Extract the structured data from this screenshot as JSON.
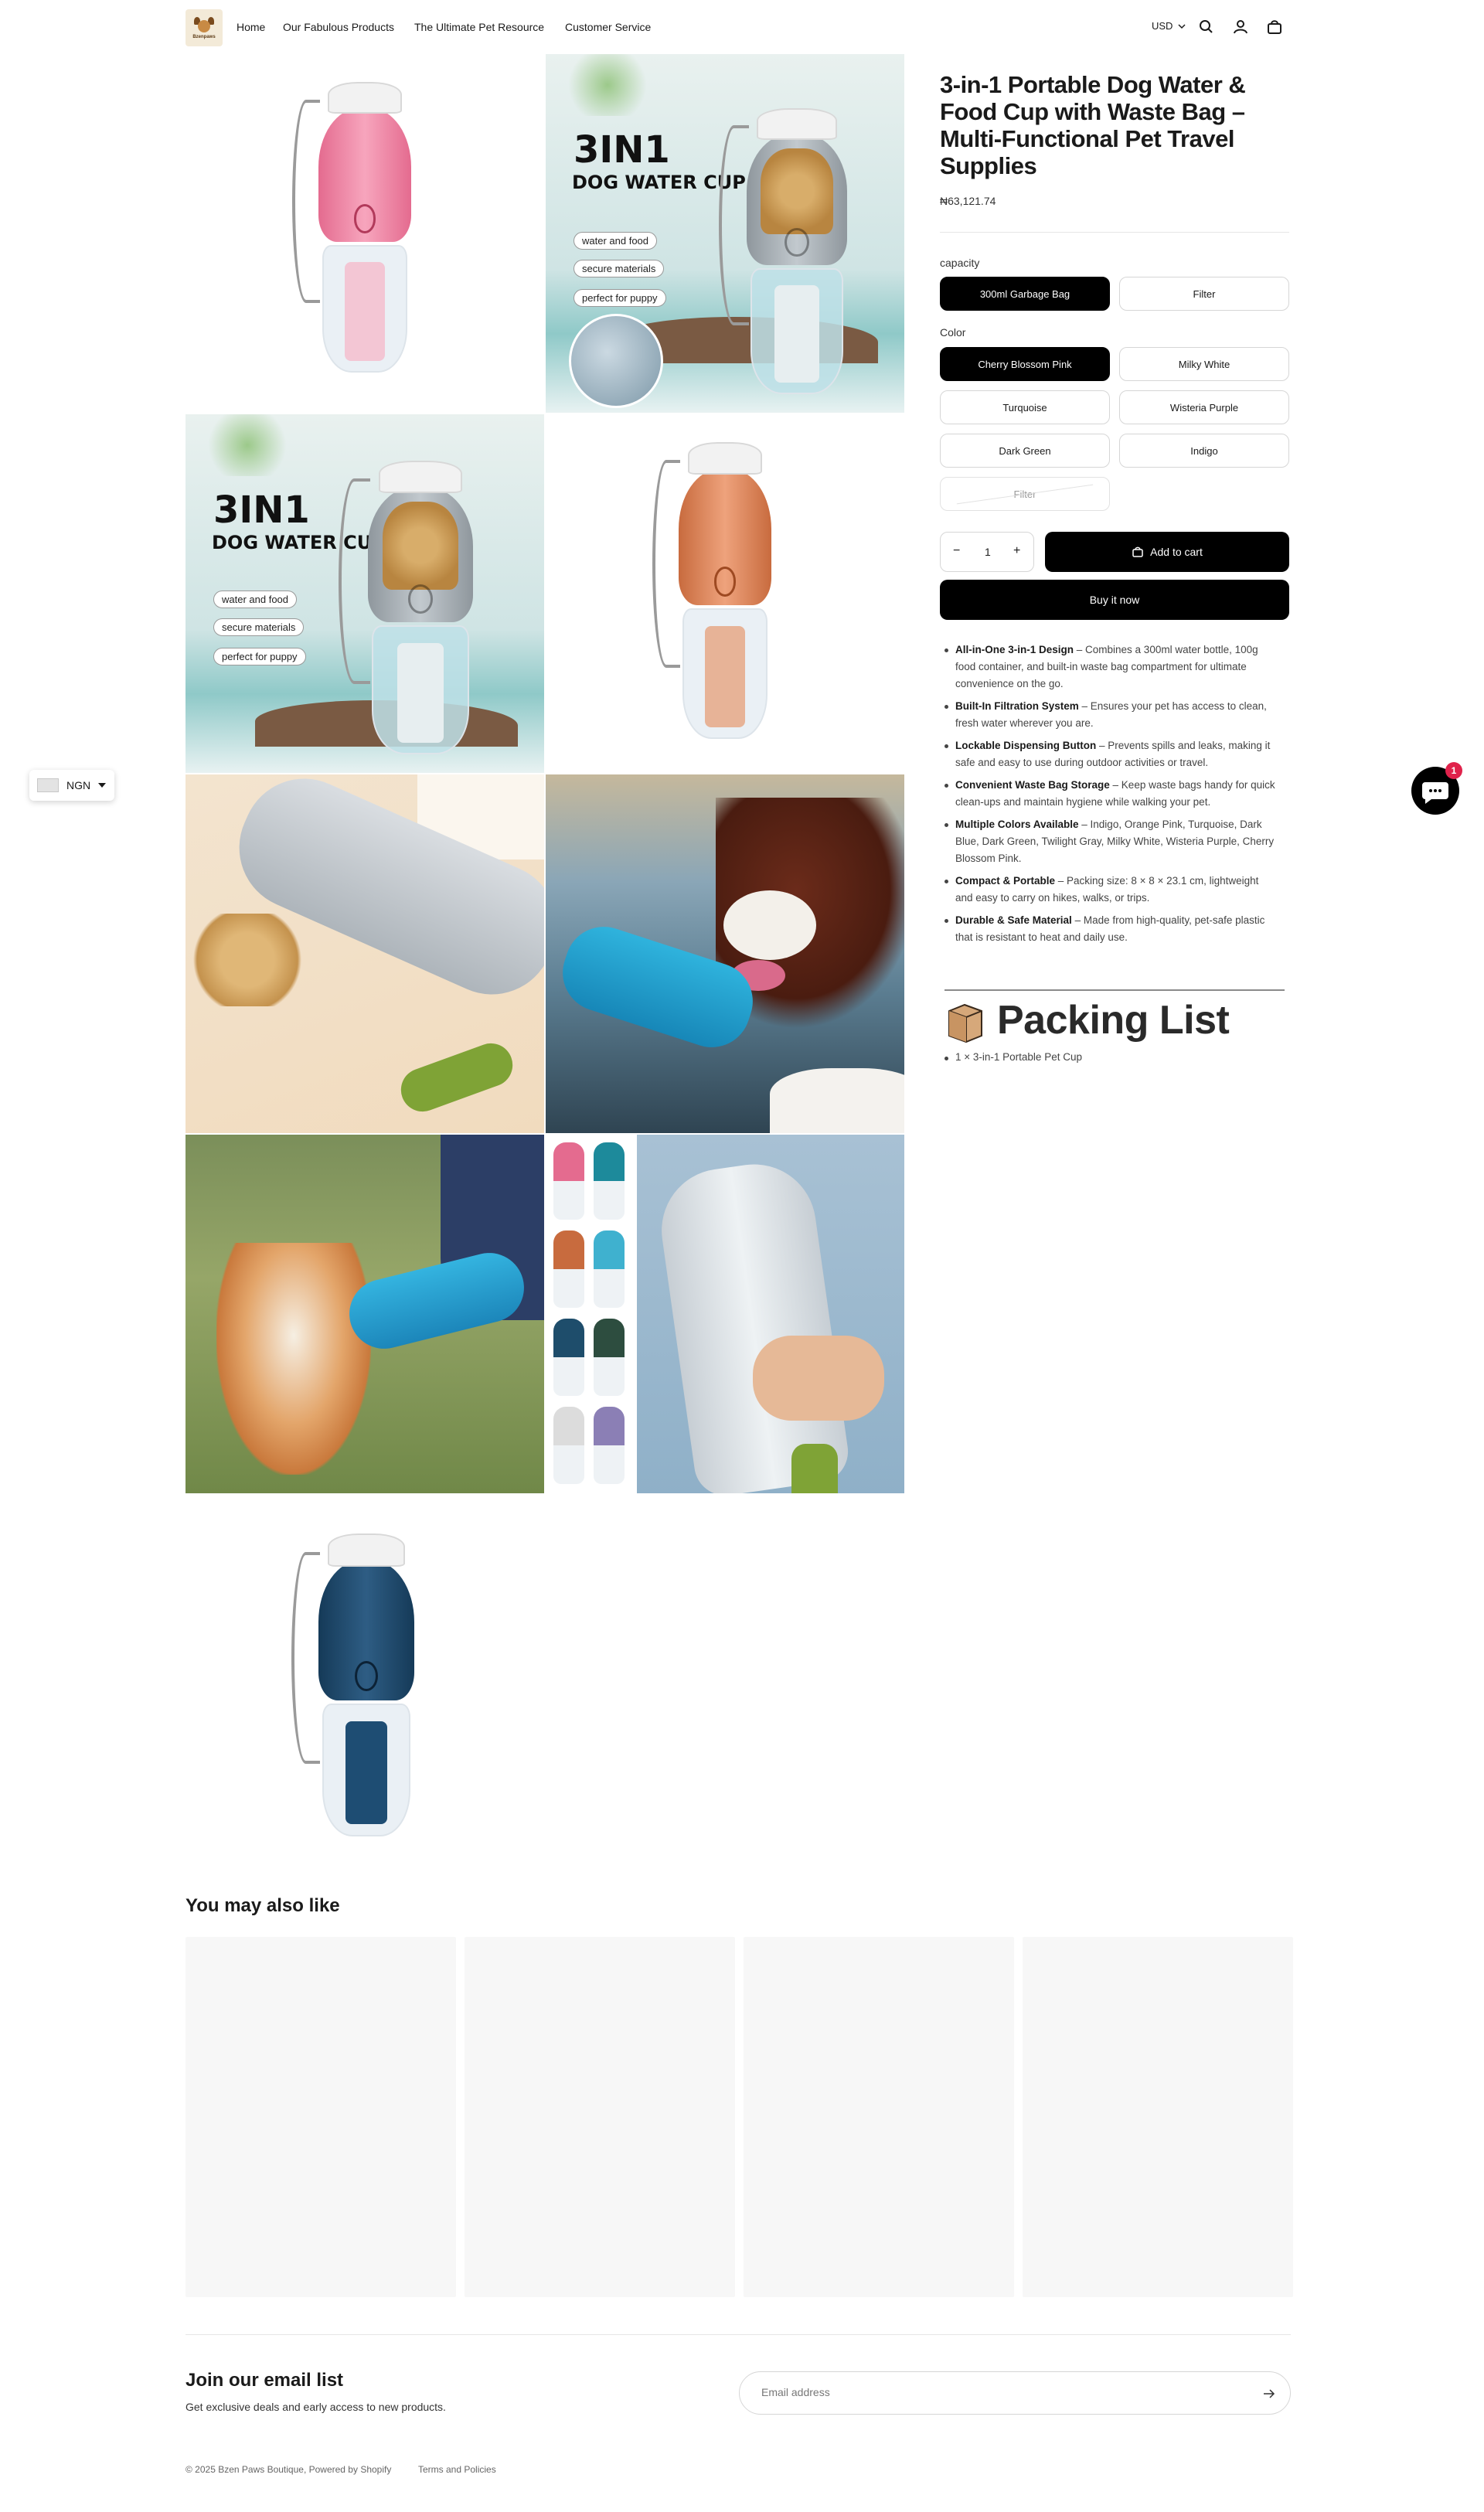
{
  "header": {
    "logo_text": "Bzenpaws",
    "nav": [
      "Home",
      "Our Fabulous Products",
      "The Ultimate Pet Resource",
      "Customer Service"
    ],
    "currency": "USD"
  },
  "gallery": {
    "promo_title": "3IN1",
    "promo_subtitle": "DOG WATER CUP",
    "promo_pills": [
      "water and food",
      "secure materials",
      "perfect for puppy"
    ]
  },
  "product": {
    "title": "3-in-1 Portable Dog Water & Food Cup with Waste Bag – Multi-Functional Pet Travel Supplies",
    "price": "₦63,121.74",
    "capacity_label": "capacity",
    "capacity_options": [
      "300ml Garbage Bag",
      "Filter"
    ],
    "color_label": "Color",
    "color_options": [
      "Cherry Blossom Pink",
      "Milky White",
      "Turquoise",
      "Wisteria Purple",
      "Dark Green",
      "Indigo",
      "Filter"
    ],
    "quantity": "1",
    "qty_minus": "−",
    "qty_plus": "+",
    "add_to_cart": "Add to cart",
    "buy_now": "Buy it now",
    "features": [
      {
        "bold": "All-in-One 3-in-1 Design",
        "text": " – Combines a 300ml water bottle, 100g food container, and built-in waste bag compartment for ultimate convenience on the go."
      },
      {
        "bold": "Built-In Filtration System",
        "text": " – Ensures your pet has access to clean, fresh water wherever you are."
      },
      {
        "bold": "Lockable Dispensing Button",
        "text": " – Prevents spills and leaks, making it safe and easy to use during outdoor activities or travel."
      },
      {
        "bold": "Convenient Waste Bag Storage",
        "text": " – Keep waste bags handy for quick clean-ups and maintain hygiene while walking your pet."
      },
      {
        "bold": "Multiple Colors Available",
        "text": " – Indigo, Orange Pink, Turquoise, Dark Blue, Dark Green, Twilight Gray, Milky White, Wisteria Purple, Cherry Blossom Pink."
      },
      {
        "bold": "Compact & Portable",
        "text": " – Packing size: 8 × 8 × 23.1 cm, lightweight and easy to carry on hikes, walks, or trips."
      },
      {
        "bold": "Durable & Safe Material",
        "text": " – Made from high-quality, pet-safe plastic that is resistant to heat and daily use."
      }
    ],
    "packing_title": "Packing List",
    "packing_items": [
      "1 × 3-in-1 Portable Pet Cup"
    ]
  },
  "currency_selector": {
    "code": "NGN"
  },
  "chat": {
    "badge": "1"
  },
  "recommendations": {
    "title": "You may also like"
  },
  "newsletter": {
    "title": "Join our email list",
    "subtitle": "Get exclusive deals and early access to new products.",
    "placeholder": "Email address"
  },
  "footer": {
    "copyright": "© 2025 Bzen Paws Boutique, Powered by Shopify",
    "policies": "Terms and Policies"
  },
  "colors": {
    "accent": "#000000",
    "badge": "#e0224b",
    "card_bg": "#f7f7f7"
  }
}
